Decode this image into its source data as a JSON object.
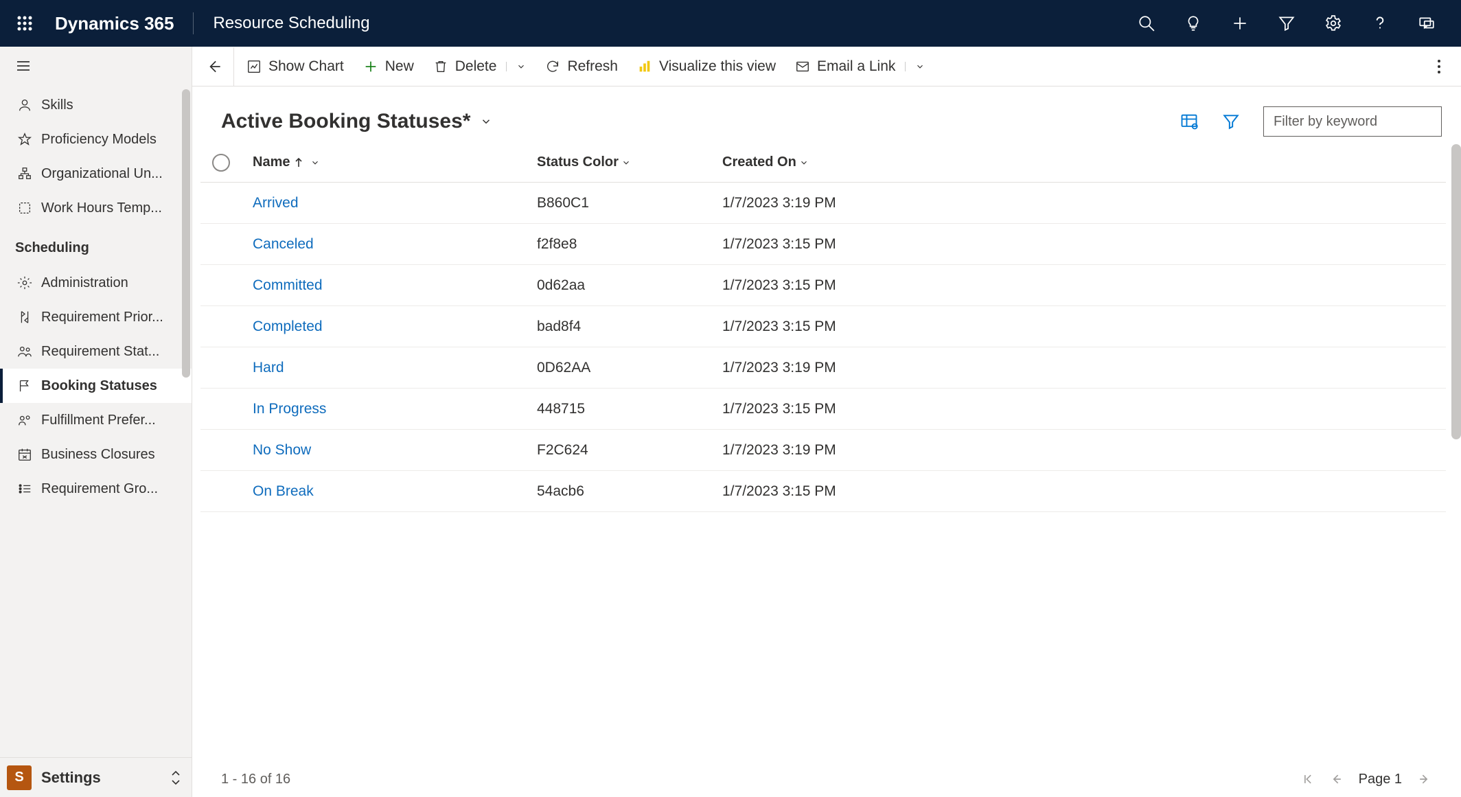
{
  "topbar": {
    "brand": "Dynamics 365",
    "area": "Resource Scheduling"
  },
  "sidebar": {
    "groups": [
      {
        "items": [
          {
            "id": "skills",
            "label": "Skills",
            "icon": "person"
          },
          {
            "id": "proficiency-models",
            "label": "Proficiency Models",
            "icon": "star"
          },
          {
            "id": "organizational-units",
            "label": "Organizational Un...",
            "icon": "org"
          },
          {
            "id": "work-hours-templates",
            "label": "Work Hours Temp...",
            "icon": "template"
          }
        ]
      },
      {
        "title": "Scheduling",
        "items": [
          {
            "id": "administration",
            "label": "Administration",
            "icon": "gear"
          },
          {
            "id": "requirement-priorities",
            "label": "Requirement Prior...",
            "icon": "priority"
          },
          {
            "id": "requirement-statuses",
            "label": "Requirement Stat...",
            "icon": "people"
          },
          {
            "id": "booking-statuses",
            "label": "Booking Statuses",
            "icon": "flag",
            "selected": true
          },
          {
            "id": "fulfillment-preferences",
            "label": "Fulfillment Prefer...",
            "icon": "people2"
          },
          {
            "id": "business-closures",
            "label": "Business Closures",
            "icon": "calendar"
          },
          {
            "id": "requirement-groups",
            "label": "Requirement Gro...",
            "icon": "list"
          }
        ]
      }
    ],
    "area_switch": {
      "chip": "S",
      "label": "Settings"
    }
  },
  "commands": {
    "show_chart": "Show Chart",
    "new": "New",
    "delete": "Delete",
    "refresh": "Refresh",
    "visualize": "Visualize this view",
    "email_link": "Email a Link"
  },
  "view": {
    "title": "Active Booking Statuses*",
    "filter_placeholder": "Filter by keyword"
  },
  "grid": {
    "columns": {
      "name": "Name",
      "status_color": "Status Color",
      "created_on": "Created On"
    },
    "rows": [
      {
        "name": "Arrived",
        "status_color": "B860C1",
        "created_on": "1/7/2023 3:19 PM"
      },
      {
        "name": "Canceled",
        "status_color": "f2f8e8",
        "created_on": "1/7/2023 3:15 PM"
      },
      {
        "name": "Committed",
        "status_color": "0d62aa",
        "created_on": "1/7/2023 3:15 PM"
      },
      {
        "name": "Completed",
        "status_color": "bad8f4",
        "created_on": "1/7/2023 3:15 PM"
      },
      {
        "name": "Hard",
        "status_color": "0D62AA",
        "created_on": "1/7/2023 3:19 PM"
      },
      {
        "name": "In Progress",
        "status_color": "448715",
        "created_on": "1/7/2023 3:15 PM"
      },
      {
        "name": "No Show",
        "status_color": "F2C624",
        "created_on": "1/7/2023 3:19 PM"
      },
      {
        "name": "On Break",
        "status_color": "54acb6",
        "created_on": "1/7/2023 3:15 PM"
      }
    ]
  },
  "pager": {
    "summary": "1 - 16 of 16",
    "page_label": "Page 1"
  }
}
